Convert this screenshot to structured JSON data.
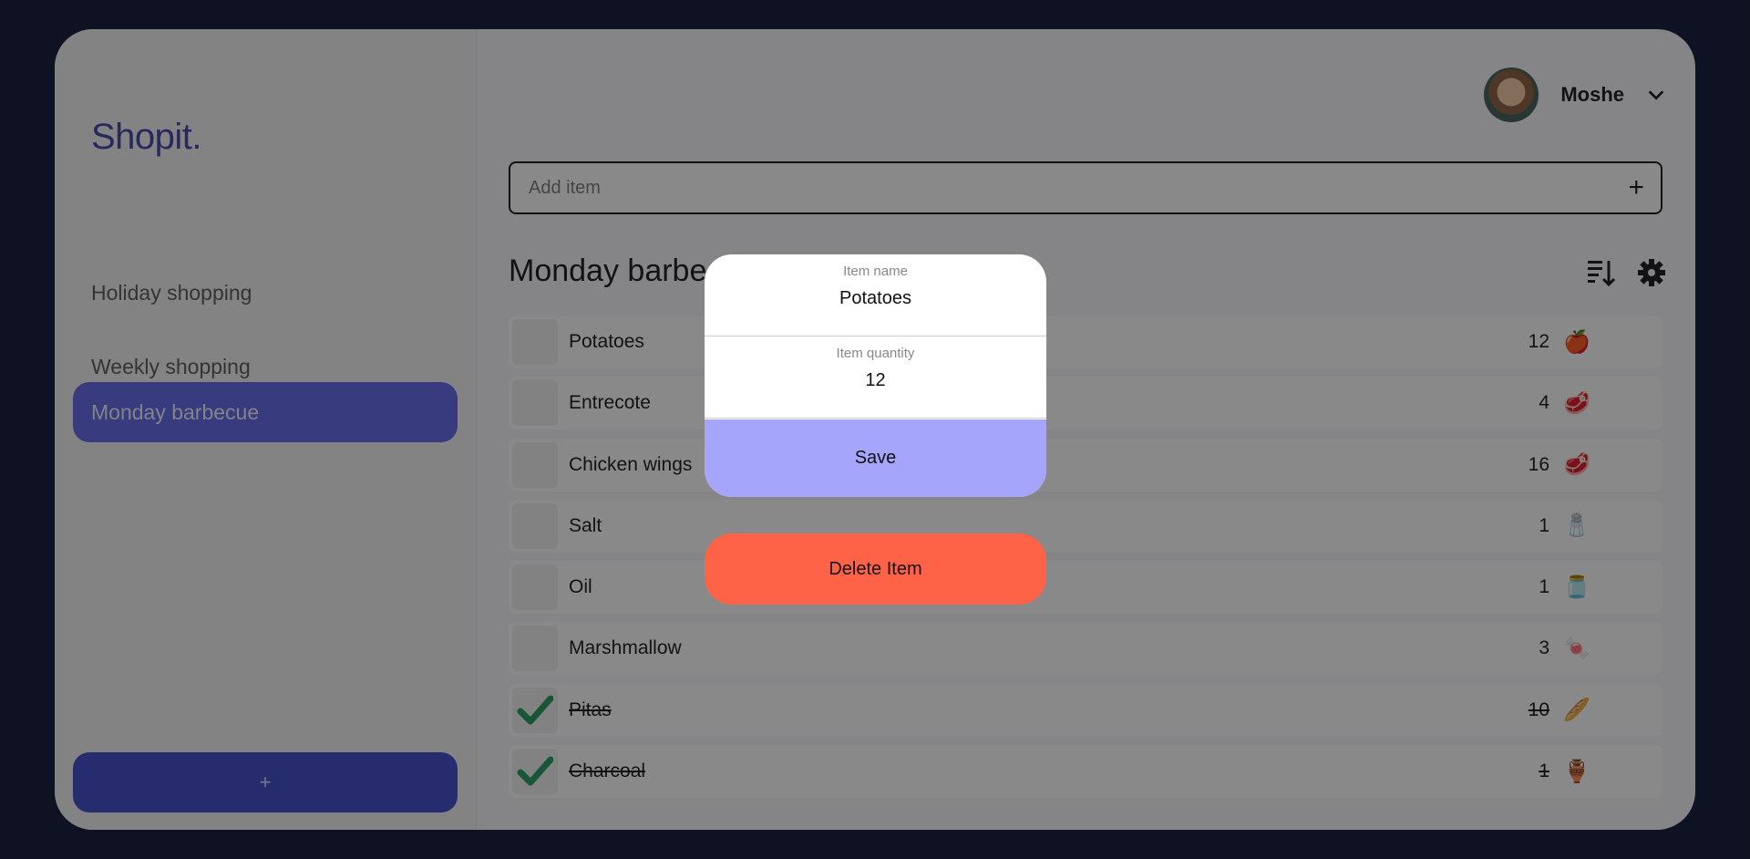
{
  "app": {
    "logo": "Shopit."
  },
  "sidebar": {
    "lists": [
      {
        "label": "Holiday shopping",
        "active": false
      },
      {
        "label": "Weekly shopping",
        "active": false
      },
      {
        "label": "Monday barbecue",
        "active": true
      }
    ],
    "add_list_label": "+"
  },
  "user": {
    "name": "Moshe"
  },
  "add_item": {
    "placeholder": "Add item",
    "button_label": "+"
  },
  "list": {
    "title": "Monday barbecue",
    "items": [
      {
        "name": "Potatoes",
        "quantity": "12",
        "icon": "🍎",
        "done": false
      },
      {
        "name": "Entrecote",
        "quantity": "4",
        "icon": "🥩",
        "done": false
      },
      {
        "name": "Chicken wings",
        "quantity": "16",
        "icon": "🥩",
        "done": false
      },
      {
        "name": "Salt",
        "quantity": "1",
        "icon": "🧂",
        "done": false
      },
      {
        "name": "Oil",
        "quantity": "1",
        "icon": "🫙",
        "done": false
      },
      {
        "name": "Marshmallow",
        "quantity": "3",
        "icon": "🍬",
        "done": false
      },
      {
        "name": "Pitas",
        "quantity": "10",
        "icon": "🥖",
        "done": true
      },
      {
        "name": "Charcoal",
        "quantity": "1",
        "icon": "🏺",
        "done": true
      }
    ]
  },
  "modal": {
    "name_label": "Item name",
    "name_value": "Potatoes",
    "quantity_label": "Item quantity",
    "quantity_value": "12",
    "save_label": "Save",
    "delete_label": "Delete Item"
  },
  "colors": {
    "accent": "#5c63e8",
    "save": "#a5a6fb",
    "delete": "#ff6347",
    "check": "#1a9a5a"
  }
}
